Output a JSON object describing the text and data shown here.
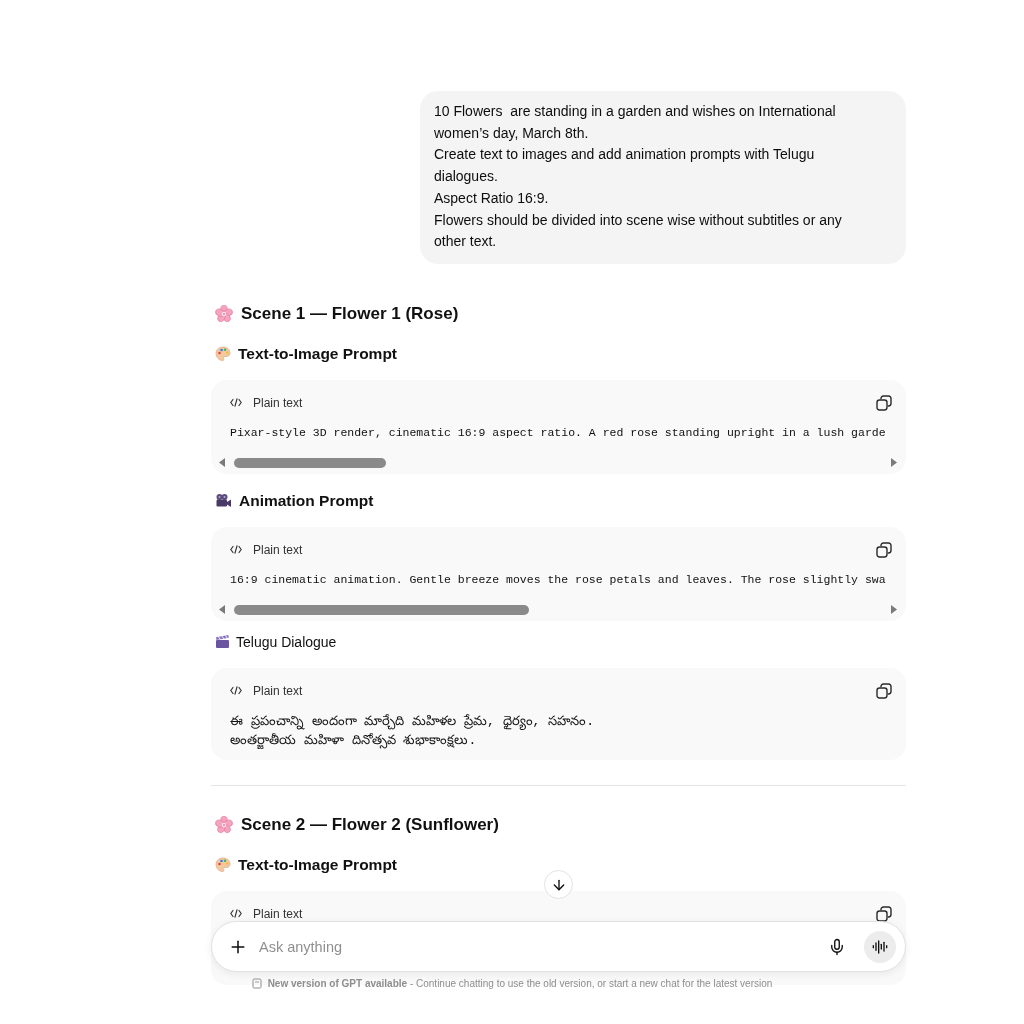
{
  "user_message": {
    "text": "10 Flowers  are standing in a garden and wishes on International women’s day, March 8th.\nCreate text to images and add animation prompts with Telugu dialogues.\nAspect Ratio 16:9.\nFlowers should be divided into scene wise without subtitles or any other text."
  },
  "scenes": [
    {
      "title": "Scene 1 — Flower 1 (Rose)",
      "sections": [
        {
          "kind": "image_prompt",
          "heading": "Text-to-Image Prompt",
          "code": {
            "language": "Plain text",
            "text": "Pixar-style 3D render, cinematic 16:9 aspect ratio. A red rose standing upright in a lush garde"
          }
        },
        {
          "kind": "animation_prompt",
          "heading": "Animation Prompt",
          "code": {
            "language": "Plain text",
            "text": "16:9 cinematic animation. Gentle breeze moves the rose petals and leaves. The rose slightly swa"
          }
        },
        {
          "kind": "dialogue",
          "heading": "Telugu Dialogue",
          "code": {
            "language": "Plain text",
            "text": "ఈ ప్రపంచాన్ని అందంగా మార్చేది మహిళల ప్రేమ, ధైర్యం, సహనం.\nఅంతర్జాతీయ మహిళా దినోత్సవ శుభాకాంక్షలు."
          }
        }
      ]
    },
    {
      "title": "Scene 2 — Flower 2 (Sunflower)",
      "sections": [
        {
          "kind": "image_prompt",
          "heading": "Text-to-Image Prompt",
          "code": {
            "language": "Plain text"
          }
        }
      ]
    }
  ],
  "composer": {
    "placeholder": "Ask anything"
  },
  "footer_notice": "**New version of GPT available** - Continue chatting to use the old version, or start a new chat for the latest version"
}
